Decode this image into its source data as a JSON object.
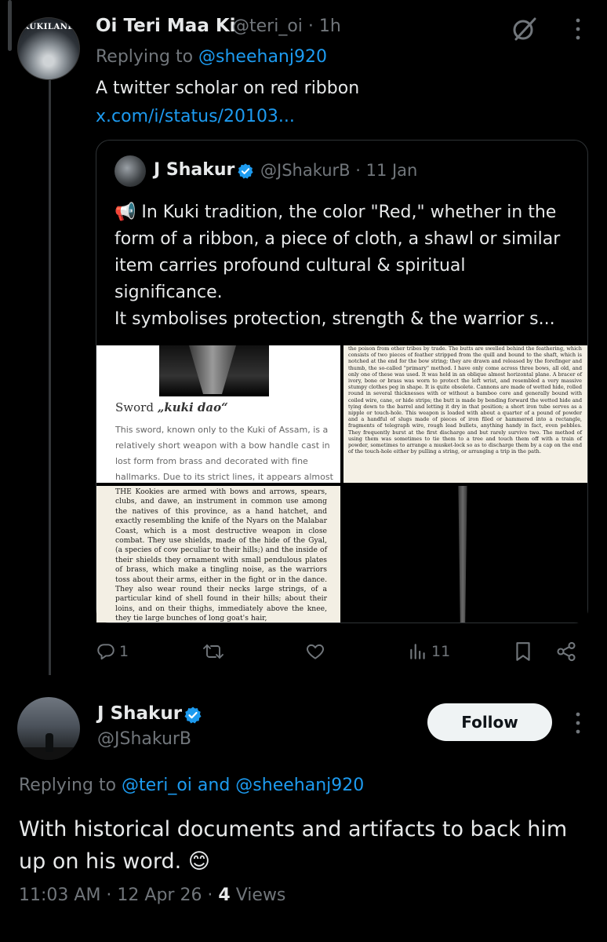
{
  "original_tweet": {
    "author_name": "Oi Teri Maa Ki",
    "handle_time": "@teri_oi · 1h",
    "avatar_banner": "KUKILAND",
    "replying_prefix": "Replying to ",
    "replying_to": "@sheehanj920",
    "text": "A twitter scholar on red ribbon",
    "link": "x.com/i/status/20103...",
    "icons": [
      "grok-icon",
      "more-icon"
    ]
  },
  "quoted_tweet": {
    "author_name": "J Shakur",
    "handle_time": "@JShakurB · 11 Jan",
    "text": "📢 In Kuki tradition, the color \"Red,\" whether in the form of a ribbon, a piece of cloth, a shawl or similar item carries profound cultural & spiritual significance.\nIt symbolises protection, strength & the warrior s...",
    "media": {
      "sword_title_prefix": "Sword ",
      "sword_title_italic": "„kuki dao“",
      "sword_body": "This sword, known only to the Kuki of Assam, is a relatively short weapon with a bow handle cast in lost form from brass and decorated with fine hallmarks. Due to its strict lines, it appears almost",
      "doc_right": "the poison from other tribes by trade. The butts are swelled behind the feathering, which consists of two pieces of feather stripped from the quill and bound to the shaft, which is notched at the end for the bow string; they are drawn and released by the forefinger and thumb, the so-called \"primary\" method. I have only come across three bows, all old, and only one of these was used. It was held in an oblique almost horizontal plane. A bracer of ivory, bone or brass was worn to protect the left wrist, and resembled a very massive stumpy clothes peg in shape. It is quite obsolete. Cannons are made of wetted hide, rolled round in several thicknesses with or without a bamboo core and generally bound with coiled wire, cane, or hide strips; the butt is made by bending forward the wetted hide and tying down to the barrel and letting it dry in that position; a short iron tube serves as a nipple or touch-hole. This weapon is loaded with about a quarter of a pound of powder and a handful of slugs made of pieces of iron filed or hammered into a rectangle, fragments of telegraph wire, rough lead bullets, anything handy in fact, even pebbles. They frequently burst at the first discharge and but rarely survive two. The method of using them was sometimes to tie them to a tree and touch them off with a train of powder, sometimes to arrange a musket-lock so as to discharge them by a cap on the end of the touch-hole either by pulling a string, or arranging a trip in the path.",
      "doc_left": "THE Kookies are armed with bows and arrows, spears, clubs, and dawe, an instrument in common use among the natives of this province, as a hand hatchet, and exactly resembling the knife of the Nyars on the Malabar Coast, which is a most destructive weapon in close combat. They use shields, made of the hide of the Gyal, (a species of cow peculiar to their hills;) and the inside of their shields they ornament with small pendulous plates of brass, which make a tingling noise, as the warriors toss about their arms, either in the fight or in the dance. They also wear round their necks large strings, of a particular kind of shell found in their hills; about their loins, and on their thighs, immediately above the knee, they tie large bunches of long goat's hair,"
    }
  },
  "actions": {
    "reply_count": "1",
    "retweet_count": "",
    "like_count": "",
    "views_count": "11"
  },
  "reply_tweet": {
    "author_name": "J Shakur",
    "handle": "@JShakurB",
    "follow_label": "Follow",
    "replying_prefix": "Replying to ",
    "replying_to": "@teri_oi and @sheehanj920",
    "text": "With historical documents and artifacts to back him up on his word. 😊",
    "timestamp": "11:03 AM · 12 Apr 26 · ",
    "views_number": "4",
    "views_label": " Views"
  },
  "colors": {
    "background": "#000000",
    "text": "#e7e9ea",
    "muted": "#71767b",
    "link": "#1d9bf0",
    "verified": "#1d9bf0"
  }
}
